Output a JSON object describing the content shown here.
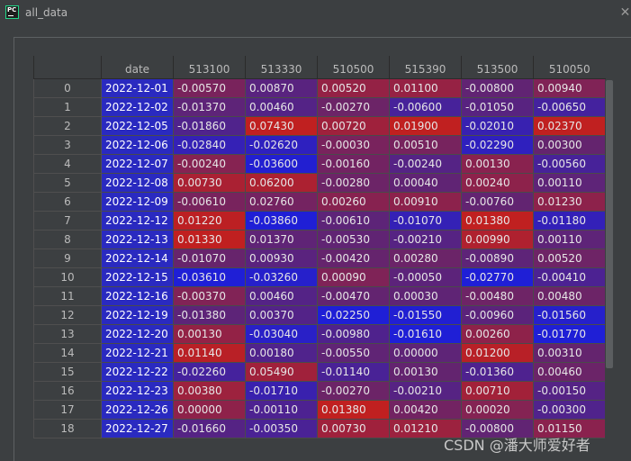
{
  "window": {
    "title": "all_data",
    "icon": "pycharm-icon",
    "icon_text": "PC",
    "close_glyph": "✕"
  },
  "table": {
    "columns": [
      "",
      "date",
      "513100",
      "513330",
      "510500",
      "515390",
      "513500",
      "510050"
    ],
    "rows": [
      {
        "index": "0",
        "date": "2022-12-01",
        "values": [
          "-0.00570",
          "0.00870",
          "0.00520",
          "0.01100",
          "-0.00800",
          "0.00940"
        ]
      },
      {
        "index": "1",
        "date": "2022-12-02",
        "values": [
          "-0.01370",
          "0.00460",
          "-0.00270",
          "-0.00600",
          "-0.01050",
          "-0.00650"
        ]
      },
      {
        "index": "2",
        "date": "2022-12-05",
        "values": [
          "-0.01860",
          "0.07430",
          "0.00720",
          "0.01900",
          "-0.02010",
          "0.02370"
        ]
      },
      {
        "index": "3",
        "date": "2022-12-06",
        "values": [
          "-0.02840",
          "-0.02620",
          "-0.00030",
          "0.00510",
          "-0.02290",
          "0.00300"
        ]
      },
      {
        "index": "4",
        "date": "2022-12-07",
        "values": [
          "-0.00240",
          "-0.03600",
          "-0.00160",
          "-0.00240",
          "0.00130",
          "-0.00560"
        ]
      },
      {
        "index": "5",
        "date": "2022-12-08",
        "values": [
          "0.00730",
          "0.06200",
          "-0.00280",
          "0.00040",
          "0.00240",
          "0.00110"
        ]
      },
      {
        "index": "6",
        "date": "2022-12-09",
        "values": [
          "-0.00610",
          "0.02760",
          "0.00260",
          "0.00910",
          "-0.00760",
          "0.01230"
        ]
      },
      {
        "index": "7",
        "date": "2022-12-12",
        "values": [
          "0.01220",
          "-0.03860",
          "-0.00610",
          "-0.01070",
          "0.01380",
          "-0.01180"
        ]
      },
      {
        "index": "8",
        "date": "2022-12-13",
        "values": [
          "0.01330",
          "0.01370",
          "-0.00530",
          "-0.00210",
          "0.00990",
          "0.00110"
        ]
      },
      {
        "index": "9",
        "date": "2022-12-14",
        "values": [
          "-0.01070",
          "0.00930",
          "-0.00420",
          "0.00280",
          "-0.00890",
          "0.00520"
        ]
      },
      {
        "index": "10",
        "date": "2022-12-15",
        "values": [
          "-0.03610",
          "-0.03260",
          "0.00090",
          "-0.00050",
          "-0.02770",
          "-0.00410"
        ]
      },
      {
        "index": "11",
        "date": "2022-12-16",
        "values": [
          "-0.00370",
          "0.00460",
          "-0.00470",
          "0.00030",
          "-0.00480",
          "0.00480"
        ]
      },
      {
        "index": "12",
        "date": "2022-12-19",
        "values": [
          "-0.01380",
          "0.00370",
          "-0.02250",
          "-0.01550",
          "-0.00960",
          "-0.01560"
        ]
      },
      {
        "index": "13",
        "date": "2022-12-20",
        "values": [
          "0.00130",
          "-0.03040",
          "-0.00980",
          "-0.01610",
          "0.00260",
          "-0.01770"
        ]
      },
      {
        "index": "14",
        "date": "2022-12-21",
        "values": [
          "0.01140",
          "0.00180",
          "-0.00550",
          "0.00000",
          "0.01200",
          "0.00310"
        ]
      },
      {
        "index": "15",
        "date": "2022-12-22",
        "values": [
          "-0.02260",
          "0.05490",
          "-0.01140",
          "0.00130",
          "-0.01360",
          "0.00460"
        ]
      },
      {
        "index": "16",
        "date": "2022-12-23",
        "values": [
          "0.00380",
          "-0.01710",
          "-0.00270",
          "-0.00210",
          "0.00710",
          "-0.00150"
        ]
      },
      {
        "index": "17",
        "date": "2022-12-26",
        "values": [
          "0.00000",
          "-0.00110",
          "0.01380",
          "0.00420",
          "0.00020",
          "-0.00300"
        ]
      },
      {
        "index": "18",
        "date": "2022-12-27",
        "values": [
          "-0.01660",
          "-0.00350",
          "0.00730",
          "0.01210",
          "-0.00800",
          "0.01150"
        ]
      }
    ]
  },
  "colors": {
    "low": "#1f1fd6",
    "high": "#c02020",
    "date_bg": "#2a2ac0"
  },
  "watermark": "CSDN @潘大师爱好者"
}
